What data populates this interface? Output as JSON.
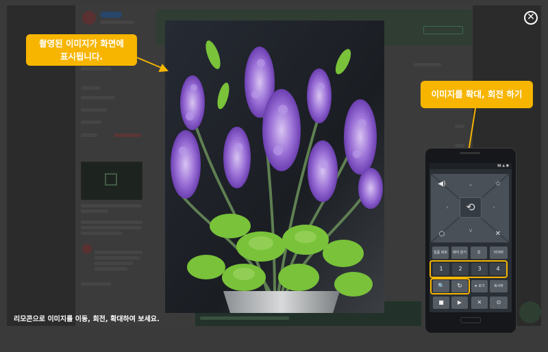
{
  "callouts": {
    "display_line1": "촬영된 이미지가 화면에",
    "display_line2": "표시됩니다.",
    "zoom_rotate": "이미지를 확대, 회전 하기"
  },
  "caption": "리모콘으로 이미지를 이동, 회전, 확대하여 보세요.",
  "close_glyph": "✕",
  "remote": {
    "keys_row1": [
      "일품 화보",
      "에어 원기",
      "알",
      "타이머"
    ],
    "keys_numbers": [
      "1",
      "2",
      "3",
      "4"
    ],
    "keys_zoom": [
      "🔍",
      "↻"
    ],
    "keys_row3_right": [
      "★ 보기",
      "복사하"
    ],
    "keys_bottom": [
      "■",
      "▶",
      "✕",
      "⊙"
    ]
  },
  "accent_color": "#f7b500"
}
